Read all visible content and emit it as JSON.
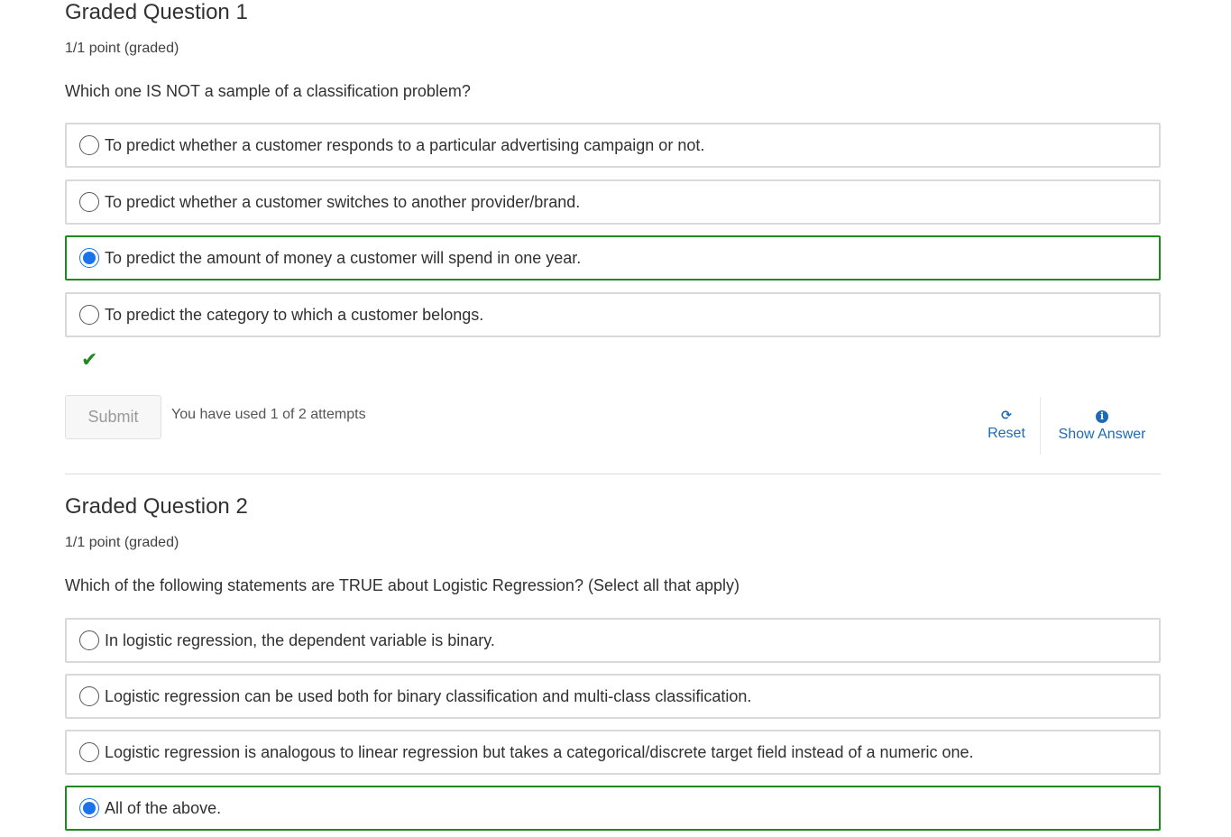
{
  "q1": {
    "title": "Graded Question 1",
    "points": "1/1 point (graded)",
    "prompt": "Which one IS NOT a sample of a classification problem?",
    "choices": [
      {
        "label": "To predict whether a customer responds to a particular advertising campaign or not.",
        "selected": false
      },
      {
        "label": "To predict whether a customer switches to another provider/brand.",
        "selected": false
      },
      {
        "label": "To predict the amount of money a customer will spend in one year.",
        "selected": true
      },
      {
        "label": "To predict the category to which a customer belongs.",
        "selected": false
      }
    ],
    "submit_label": "Submit",
    "attempts_text": "You have used 1 of 2 attempts",
    "reset_label": "Reset",
    "show_answer_label": "Show Answer"
  },
  "q2": {
    "title": "Graded Question 2",
    "points": "1/1 point (graded)",
    "prompt": "Which of the following statements are TRUE about Logistic Regression? (Select all that apply)",
    "choices": [
      {
        "label": "In logistic regression, the dependent variable is binary.",
        "selected": false
      },
      {
        "label": "Logistic regression can be used both for binary classification and multi-class classification.",
        "selected": false
      },
      {
        "label": "Logistic regression is analogous to linear regression but takes a categorical/discrete target field instead of a numeric one.",
        "selected": false
      },
      {
        "label": "All of the above.",
        "selected": true
      }
    ]
  },
  "icons": {
    "correct": "check-icon",
    "reset": "refresh-icon",
    "show_answer": "info-icon"
  },
  "colors": {
    "correct_border": "#1e8a1e",
    "selected_radio": "#1a73e8",
    "link": "#1d6bb8"
  }
}
